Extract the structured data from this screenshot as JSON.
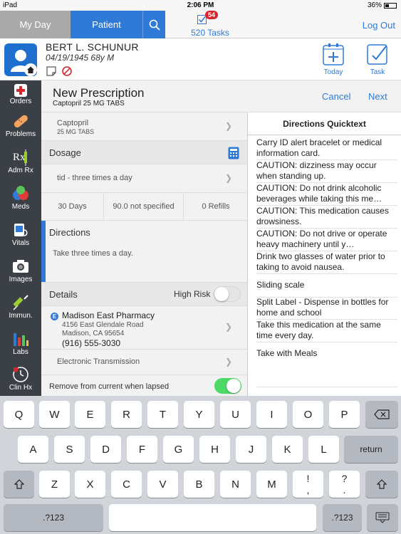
{
  "status_bar": {
    "device": "iPad",
    "time": "2:06 PM",
    "battery": "36%"
  },
  "nav": {
    "my_day": "My Day",
    "patient": "Patient",
    "tasks_badge": "54",
    "tasks_label": "520 Tasks",
    "logout": "Log Out"
  },
  "patient": {
    "name": "BERT L. SCHUNUR",
    "dob": "04/19/1945 68y M",
    "today_label": "Today",
    "task_label": "Task"
  },
  "rail": [
    {
      "label": "Orders",
      "icon": "orders-icon"
    },
    {
      "label": "Problems",
      "icon": "problems-icon"
    },
    {
      "label": "Adm Rx",
      "icon": "adm-rx-icon"
    },
    {
      "label": "Meds",
      "icon": "meds-icon"
    },
    {
      "label": "Vitals",
      "icon": "vitals-icon"
    },
    {
      "label": "Images",
      "icon": "camera-icon"
    },
    {
      "label": "Immun.",
      "icon": "syringe-icon"
    },
    {
      "label": "Labs",
      "icon": "labs-icon"
    },
    {
      "label": "Clin Hx",
      "icon": "clin-hx-icon"
    }
  ],
  "form": {
    "title": "New Prescription",
    "subtitle": "Captopril 25 MG TABS",
    "cancel": "Cancel",
    "next": "Next",
    "drug_name": "Captopril",
    "drug_dose": "25 MG TABS",
    "dosage_label": "Dosage",
    "frequency": "tid - three times a day",
    "days": "30 Days",
    "quantity": "90.0 not specified",
    "refills": "0 Refills",
    "directions_label": "Directions",
    "directions_text": "Take three times a day.",
    "details_label": "Details",
    "high_risk_label": "High Risk",
    "high_risk_on": false,
    "pharmacy_badge": "E",
    "pharmacy_name": "Madison East Pharmacy",
    "pharmacy_addr1": "4156 East Glendale Road",
    "pharmacy_addr2": "Madison, CA 95654",
    "pharmacy_phone": "(916) 555-3030",
    "transmission": "Electronic Transmission",
    "remove_label": "Remove from current when lapsed",
    "remove_on": true
  },
  "quicktext": {
    "title": "Directions Quicktext",
    "items": [
      "Carry ID alert bracelet or medical information card.",
      "CAUTION:  dizziness may occur when standing up.",
      "CAUTION:  Do not drink alcoholic beverages while taking this me…",
      "CAUTION:  This medication causes drowsiness.",
      "CAUTION: Do not drive or operate heavy machinery until y…",
      "Drink two glasses of water prior to taking to avoid nausea.",
      "Sliding scale",
      "Split Label - Dispense in bottles for home and school",
      "Take this medication at the same time every day.",
      "Take with Meals"
    ]
  },
  "keyboard": {
    "row1": [
      "Q",
      "W",
      "E",
      "R",
      "T",
      "Y",
      "U",
      "I",
      "O",
      "P"
    ],
    "row2": [
      "A",
      "S",
      "D",
      "F",
      "G",
      "H",
      "J",
      "K",
      "L"
    ],
    "row3": [
      "Z",
      "X",
      "C",
      "V",
      "B",
      "N",
      "M"
    ],
    "excl": [
      "!",
      ","
    ],
    "ques": [
      "?",
      "."
    ],
    "return_label": "return",
    "numbers_label": ".?123"
  },
  "colors": {
    "accent": "#2f7ad6",
    "rail": "#3b3f46",
    "badge": "#d9262e",
    "toggle_on": "#4cd964"
  }
}
